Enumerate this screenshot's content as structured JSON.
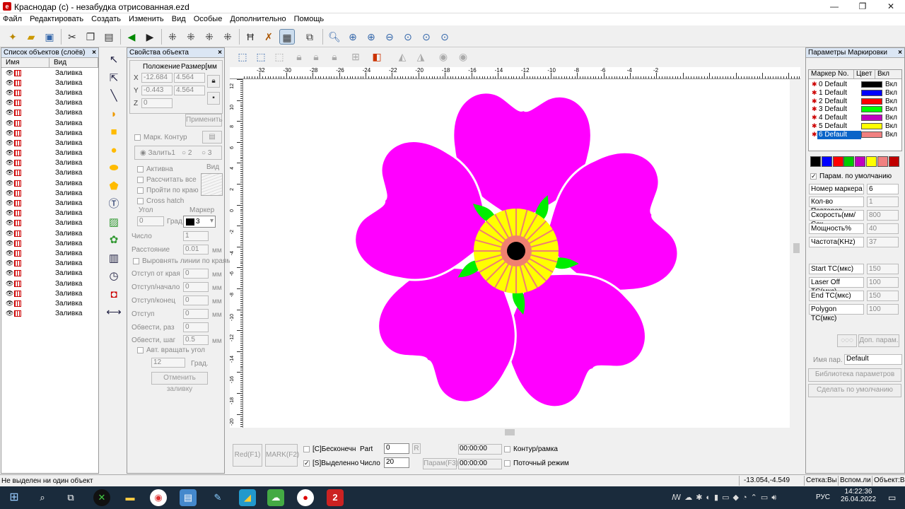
{
  "window": {
    "title": "Краснодар (с) - незабудка отрисованная.ezd"
  },
  "menu": [
    "Файл",
    "Редактировать",
    "Создать",
    "Изменить",
    "Вид",
    "Особые",
    "Дополнительно",
    "Помощь"
  ],
  "objects_panel": {
    "title": "Список объектов (слоёв)",
    "col_name": "Имя",
    "col_view": "Вид",
    "item_label": "Заливка",
    "item_count": 25
  },
  "props_panel": {
    "title": "Свойства объекта",
    "pos_label": "Положение",
    "size_label": "Размер[мм",
    "x_pos": "-12.684",
    "x_size": "4.564",
    "y_pos": "-0.443",
    "y_size": "4.564",
    "z": "0",
    "apply": "Применить",
    "mark_contour": "Марк. Контур",
    "fill1": "Залить1",
    "fill2": "2",
    "fill3": "3",
    "active": "Активна",
    "view": "Вид",
    "calc_all": "Рассчитать все",
    "pass_edge": "Пройти по краю",
    "cross_hatch": "Cross hatch",
    "angle": "Угол",
    "pen": "Маркер",
    "angle_val": "0",
    "deg": "Град",
    "pen_val": "3",
    "number": "Число",
    "number_val": "1",
    "distance": "Расстояние",
    "distance_val": "0.01",
    "mm": "мм",
    "align_lines": "Выровнять линии по краям",
    "edge_offset": "Отступ от края",
    "edge_offset_val": "0",
    "offset_start": "Отступ/начало",
    "offset_start_val": "0",
    "offset_end": "Отступ/конец",
    "offset_end_val": "0",
    "offset": "Отступ",
    "offset_val": "0",
    "loops": "Обвести, раз",
    "loops_val": "0",
    "loop_step": "Обвести, шаг",
    "loop_step_val": "0.5",
    "auto_rotate": "Авт. вращать угол",
    "rotate_val": "12",
    "deg2": "Град.",
    "cancel_fill": "Отменить заливку"
  },
  "ruler_top": [
    "-32",
    "-30",
    "-28",
    "-26",
    "-24",
    "-22",
    "-20",
    "-18",
    "-16",
    "-14",
    "-12",
    "-10",
    "-8",
    "-6",
    "-4",
    "-2"
  ],
  "ruler_left": [
    "12",
    "10",
    "8",
    "6",
    "4",
    "2",
    "0",
    "-2",
    "-4",
    "-6",
    "-8",
    "-10",
    "-12",
    "-14",
    "-16",
    "-18",
    "-20"
  ],
  "flower": {
    "petal_color": "#ff00ff",
    "center_ring": "#ffff00",
    "sepal_color": "#00ee00",
    "salmon": "#f08070",
    "core": "#000000"
  },
  "control": {
    "red_btn": "Red(F1)",
    "mark_btn": "MARK(F2)",
    "continuous": "[C]Бесконечн",
    "part": "Part",
    "part_val": "0",
    "r": "R",
    "selected": "[S]Выделенно",
    "count": "Число",
    "count_val": "20",
    "param": "Парам(F3)",
    "time1": "00:00:00",
    "time2": "00:00:00",
    "contour": "Контур/рамка",
    "stream": "Поточный режим"
  },
  "marking": {
    "title": "Параметры Маркировки",
    "col_pen": "Маркер No.",
    "col_color": "Цвет",
    "col_on": "Вкл",
    "pens": [
      {
        "name": "0 Default",
        "color": "#000000",
        "on": "Вкл"
      },
      {
        "name": "1 Default",
        "color": "#0000ff",
        "on": "Вкл"
      },
      {
        "name": "2 Default",
        "color": "#ff0000",
        "on": "Вкл"
      },
      {
        "name": "3 Default",
        "color": "#00ff00",
        "on": "Вкл"
      },
      {
        "name": "4 Default",
        "color": "#c000c0",
        "on": "Вкл"
      },
      {
        "name": "5 Default",
        "color": "#ffff00",
        "on": "Вкл"
      },
      {
        "name": "6 Default",
        "color": "#f08080",
        "on": "Вкл"
      }
    ],
    "swatches": [
      "#000000",
      "#0000ff",
      "#ff0000",
      "#00cc00",
      "#c000c0",
      "#ffff00",
      "#f08080",
      "#c00000"
    ],
    "default_params": "Парам. по умолчанию",
    "pen_number": "Номер маркера",
    "pen_number_val": "6",
    "repeat": "Кол-во Повторов",
    "repeat_val": "1",
    "speed": "Скорость(мм/Сек",
    "speed_val": "800",
    "power": "Мощность%",
    "power_val": "40",
    "freq": "Частота(KHz)",
    "freq_val": "37",
    "start_tc": "Start TC(мкс)",
    "start_tc_val": "150",
    "laser_off": "Laser Off TC(мкс)",
    "laser_off_val": "100",
    "end_tc": "End TC(мкс)",
    "end_tc_val": "150",
    "polygon": "Polygon TC(мкс)",
    "polygon_val": "100",
    "more": "Доп. парам.",
    "param_name": "Имя пар.",
    "param_name_val": "Default",
    "library": "Библиотека параметров",
    "make_default": "Сделать по умолчанию"
  },
  "status": {
    "message": "Не выделен ни один объект",
    "coords": "-13.054,-4.549",
    "grid": "Сетка:Вык",
    "aux": "Вспом.ли",
    "object": "Объект:Вы"
  },
  "taskbar": {
    "lang": "РУС",
    "time": "14:22:36",
    "date": "26.04.2022"
  }
}
